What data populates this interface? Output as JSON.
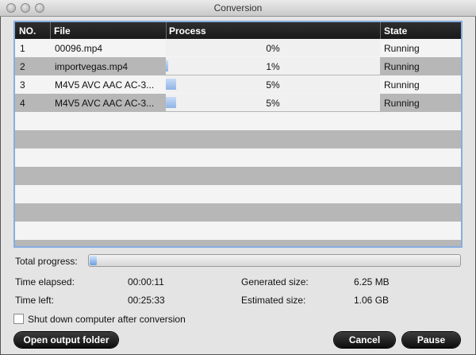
{
  "window": {
    "title": "Conversion"
  },
  "table": {
    "headers": {
      "no": "NO.",
      "file": "File",
      "process": "Process",
      "state": "State"
    },
    "rows": [
      {
        "no": "1",
        "file": "00096.mp4",
        "progress_percent": 0,
        "process": "0%",
        "state": "Running"
      },
      {
        "no": "2",
        "file": "importvegas.mp4",
        "progress_percent": 1,
        "process": "1%",
        "state": "Running"
      },
      {
        "no": "3",
        "file": "M4V5 AVC AAC AC-3...",
        "progress_percent": 5,
        "process": "5%",
        "state": "Running"
      },
      {
        "no": "4",
        "file": "M4V5 AVC AAC AC-3...",
        "progress_percent": 5,
        "process": "5%",
        "state": "Running"
      }
    ]
  },
  "progress": {
    "label": "Total progress:",
    "percent": 2
  },
  "stats": {
    "time_elapsed_label": "Time elapsed:",
    "time_elapsed": "00:00:11",
    "time_left_label": "Time left:",
    "time_left": "00:25:33",
    "generated_size_label": "Generated size:",
    "generated_size": "6.25 MB",
    "estimated_size_label": "Estimated size:",
    "estimated_size": "1.06 GB"
  },
  "shutdown": {
    "label": "Shut down computer after conversion",
    "checked": false
  },
  "buttons": {
    "open_folder": "Open output folder",
    "cancel": "Cancel",
    "pause": "Pause"
  },
  "colors": {
    "selection_border": "#86aee0",
    "progress_fill": "#8fb3e6",
    "header_bg": "#1a1a1a"
  }
}
